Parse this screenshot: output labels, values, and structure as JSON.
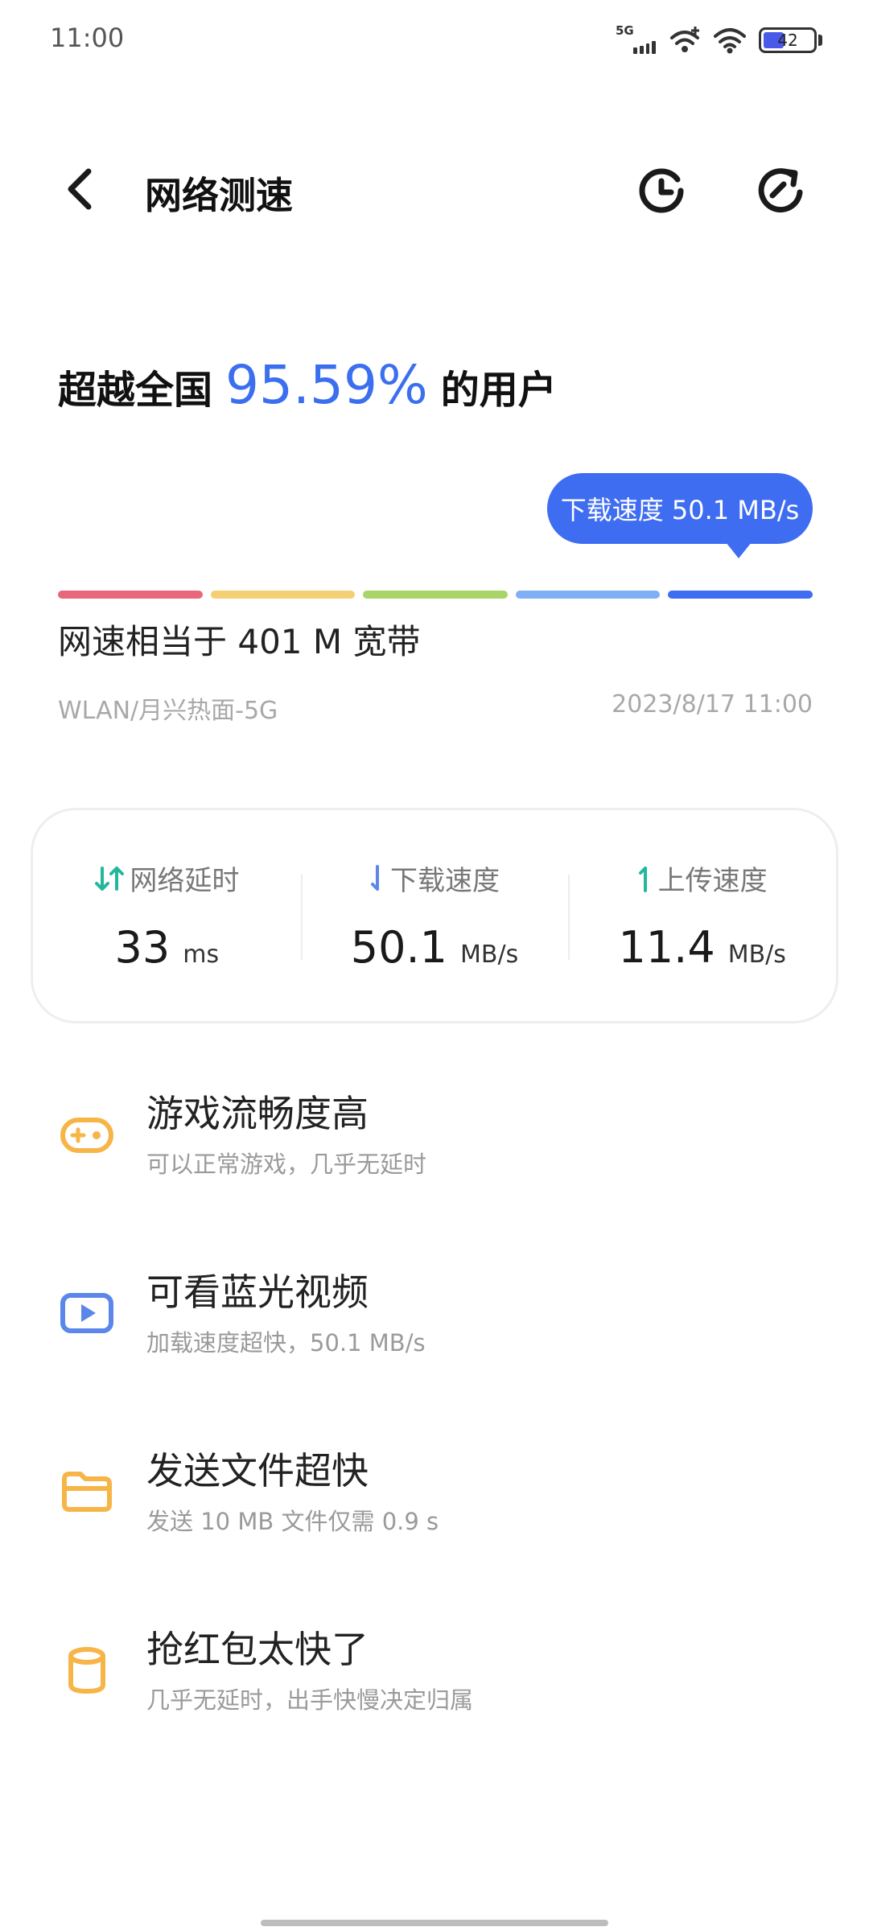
{
  "status_bar": {
    "time": "11:00",
    "network_label": "5G",
    "battery_level": "42",
    "battery_fraction": 0.42,
    "icons": [
      "5g-signal-icon",
      "mobile-data-icon",
      "wifi-icon",
      "battery-icon"
    ]
  },
  "header": {
    "title": "网络测速",
    "back_icon": "chevron-left-icon",
    "history_icon": "history-clock-icon",
    "retest_icon": "refresh-icon"
  },
  "result": {
    "prefix": "超越全国",
    "percent": "95.59%",
    "suffix": "的用户"
  },
  "tooltip": {
    "label": "下载速度 50.1 MB/s"
  },
  "scale": {
    "colors": [
      "#e8677a",
      "#f4cf74",
      "#a8d46a",
      "#7fb0f5",
      "#3f6df2"
    ]
  },
  "equivalent": "网速相当于 401 M 宽带",
  "network_name": "WLAN/月兴热面-5G",
  "test_time": "2023/8/17 11:00",
  "metrics": [
    {
      "label": "网络延时",
      "value": "33",
      "unit": "ms",
      "icon": "latency-arrows-icon",
      "color": "#23b89b"
    },
    {
      "label": "下载速度",
      "value": "50.1",
      "unit": "MB/s",
      "icon": "download-arrow-icon",
      "color": "#5b87ea"
    },
    {
      "label": "上传速度",
      "value": "11.4",
      "unit": "MB/s",
      "icon": "upload-arrow-icon",
      "color": "#23b89b"
    }
  ],
  "features": [
    {
      "title": "游戏流畅度高",
      "subtitle": "可以正常游戏，几乎无延时",
      "icon": "gamepad-icon",
      "color": "#f7b548"
    },
    {
      "title": "可看蓝光视频",
      "subtitle": "加载速度超快，50.1 MB/s",
      "icon": "video-play-icon",
      "color": "#5b87ea"
    },
    {
      "title": "发送文件超快",
      "subtitle": "发送 10 MB 文件仅需 0.9 s",
      "icon": "folder-icon",
      "color": "#f7b548"
    },
    {
      "title": "抢红包太快了",
      "subtitle": "几乎无延时，出手快慢决定归属",
      "icon": "red-packet-icon",
      "color": "#f7b548"
    }
  ]
}
